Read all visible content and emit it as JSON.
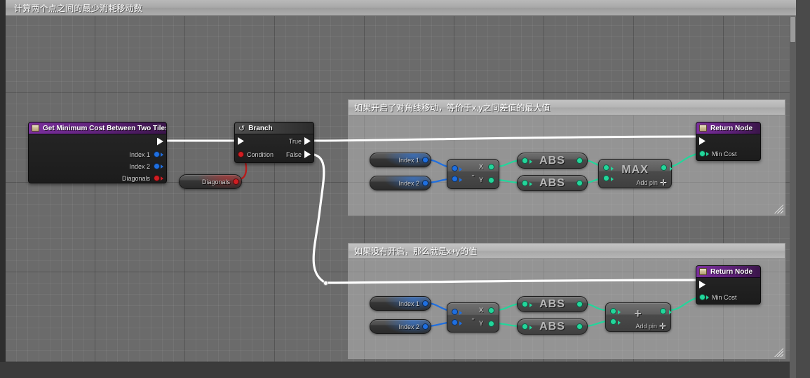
{
  "window": {
    "title": "计算两个点之间的最少消耗移动数"
  },
  "comments": [
    {
      "text": "如果开启了对角线移动，等价于x,y之间差值的最大值"
    },
    {
      "text": "如果没有开启，那么就是x+y的值"
    }
  ],
  "nodes": {
    "entry": {
      "title": "Get Minimum Cost Between Two Tiles",
      "icon": "function-icon",
      "outputs": [
        {
          "label": "Index 1",
          "type": "int",
          "color": "#1f6fe0"
        },
        {
          "label": "Index 2",
          "type": "int",
          "color": "#1f6fe0"
        },
        {
          "label": "Diagonals",
          "type": "bool",
          "color": "#d11d22"
        }
      ]
    },
    "branch": {
      "title": "Branch",
      "icon": "branch-icon",
      "condition_label": "Condition",
      "true_label": "True",
      "false_label": "False"
    },
    "diagonals_var": {
      "label": "Diagonals",
      "type": "bool",
      "color": "#d11d22"
    },
    "return_top": {
      "title": "Return Node",
      "icon": "function-icon",
      "output_label": "Min Cost",
      "output_color": "#23d69b"
    },
    "return_bottom": {
      "title": "Return Node",
      "icon": "function-icon",
      "output_label": "Min Cost",
      "output_color": "#23d69b"
    }
  },
  "branch_top": {
    "index1_label": "Index 1",
    "index2_label": "Index 2",
    "subtract_symbol": "-",
    "subtract_out_x": "X",
    "subtract_out_y": "Y",
    "abs_a": "ABS",
    "abs_b": "ABS",
    "combine_label": "MAX",
    "combine_addpin": "Add pin",
    "combine_plus": "✛"
  },
  "branch_bottom": {
    "index1_label": "Index 1",
    "index2_label": "Index 2",
    "subtract_symbol": "-",
    "subtract_out_x": "X",
    "subtract_out_y": "Y",
    "abs_a": "ABS",
    "abs_b": "ABS",
    "combine_label": "+",
    "combine_addpin": "Add pin",
    "combine_plus": "✛"
  },
  "colors": {
    "exec_wire": "#ffffff",
    "int_wire": "#1f6fe0",
    "bool_wire": "#b81c1c",
    "float_wire": "#23d69b",
    "node_header": "#5c2176",
    "canvas": "#6b6b6b"
  }
}
